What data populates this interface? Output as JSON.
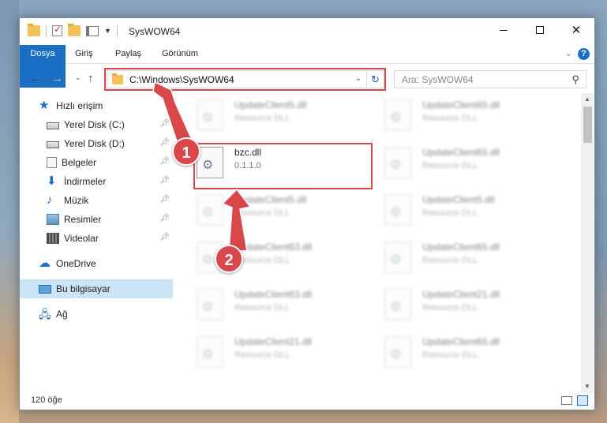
{
  "window": {
    "title": "SysWOW64"
  },
  "ribbon": {
    "tabs": [
      "Dosya",
      "Giriş",
      "Paylaş",
      "Görünüm"
    ],
    "help": "?"
  },
  "address": {
    "path": "C:\\Windows\\SysWOW64"
  },
  "search": {
    "placeholder": "Ara: SysWOW64"
  },
  "nav": {
    "quick_access": "Hızlı erişim",
    "items": [
      "Yerel Disk (C:)",
      "Yerel Disk (D:)",
      "Belgeler",
      "İndirmeler",
      "Müzik",
      "Resimler",
      "Videolar"
    ],
    "onedrive": "OneDrive",
    "this_pc": "Bu bilgisayar",
    "network": "Ağ"
  },
  "files": {
    "left": [
      {
        "name": "UpdateClient5.dll",
        "desc": "Resource DLL"
      },
      {
        "name": "bzc.dll",
        "desc": "0.1.1.0"
      },
      {
        "name": "UpdateClient5.dll",
        "desc": "Resource DLL"
      },
      {
        "name": "UpdateClient63.dll",
        "desc": "Resource DLL"
      },
      {
        "name": "UpdateClient63.dll",
        "desc": "Resource DLL"
      },
      {
        "name": "UpdateClient21.dll",
        "desc": "Resource DLL"
      }
    ],
    "right": [
      {
        "name": "UpdateClient65.dll",
        "desc": "Resource DLL"
      },
      {
        "name": "UpdateClient65.dll",
        "desc": "Resource DLL"
      },
      {
        "name": "UpdateClient5.dll",
        "desc": "Resource DLL"
      },
      {
        "name": "UpdateClient65.dll",
        "desc": "Resource DLL"
      },
      {
        "name": "UpdateClient21.dll",
        "desc": "Resource DLL"
      },
      {
        "name": "UpdateClient65.dll",
        "desc": "Resource DLL"
      }
    ]
  },
  "status": {
    "count": "120 öğe"
  },
  "callouts": {
    "one": "1",
    "two": "2"
  },
  "colors": {
    "accent": "#1a6fc4",
    "highlight": "#d9474a",
    "selected": "#cce4f7"
  }
}
